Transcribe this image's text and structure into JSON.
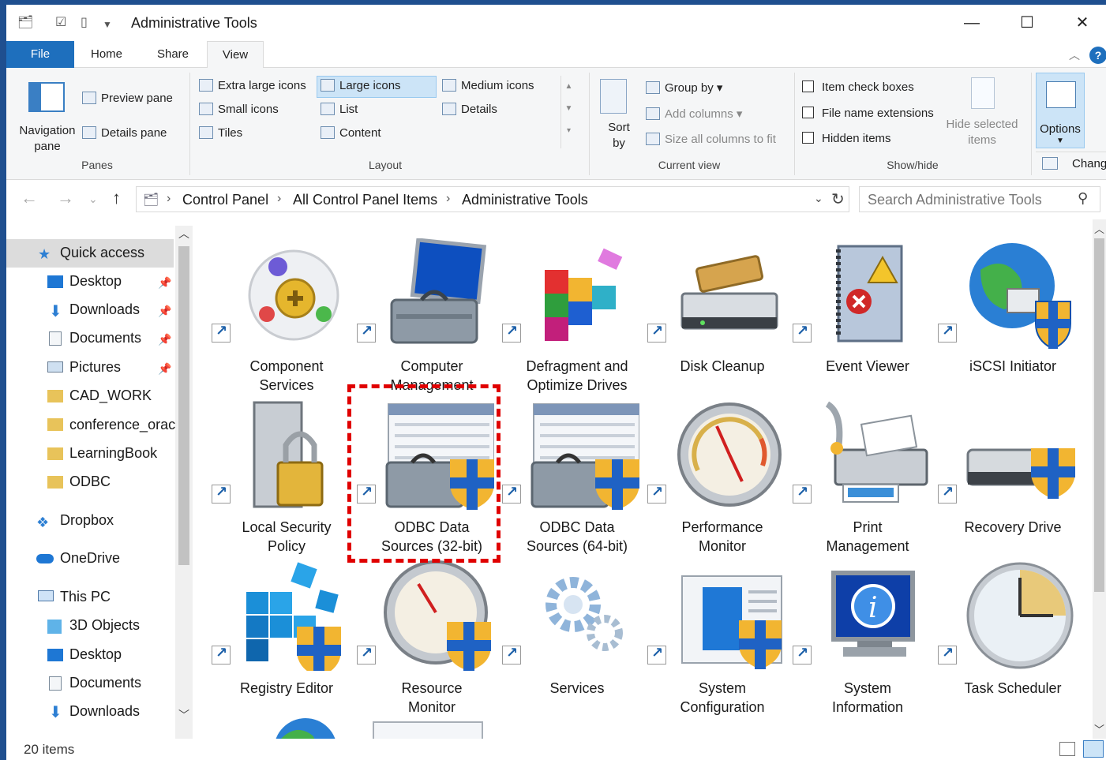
{
  "window": {
    "title": "Administrative Tools",
    "controls": {
      "minimize": "—",
      "maximize": "☐",
      "close": "✕"
    }
  },
  "ribbon_tabs": [
    "File",
    "Home",
    "Share",
    "View"
  ],
  "ribbon": {
    "panes": {
      "navigation_pane": "Navigation pane",
      "preview_pane": "Preview pane",
      "details_pane": "Details pane",
      "group_label": "Panes"
    },
    "layout": {
      "items": [
        "Extra large icons",
        "Large icons",
        "Medium icons",
        "Small icons",
        "List",
        "Details",
        "Tiles",
        "Content"
      ],
      "selected": "Large icons",
      "group_label": "Layout"
    },
    "current_view": {
      "sort_by": "Sort by",
      "group_by": "Group by",
      "add_columns": "Add columns",
      "size_all_columns": "Size all columns to fit",
      "group_label": "Current view"
    },
    "show_hide": {
      "item_check_boxes": "Item check boxes",
      "file_name_extensions": "File name extensions",
      "hidden_items": "Hidden items",
      "hide_selected_items": "Hide selected items",
      "group_label": "Show/hide"
    },
    "options": {
      "label": "Options",
      "change": "Chang"
    }
  },
  "address": {
    "crumbs": [
      "Control Panel",
      "All Control Panel Items",
      "Administrative Tools"
    ],
    "search_placeholder": "Search Administrative Tools"
  },
  "nav_pane": {
    "quick_access": "Quick access",
    "items": [
      {
        "label": "Desktop",
        "pinned": true
      },
      {
        "label": "Downloads",
        "pinned": true
      },
      {
        "label": "Documents",
        "pinned": true
      },
      {
        "label": "Pictures",
        "pinned": true
      },
      {
        "label": "CAD_WORK",
        "pinned": false
      },
      {
        "label": "conference_orac",
        "pinned": false
      },
      {
        "label": "LearningBook",
        "pinned": false
      },
      {
        "label": "ODBC",
        "pinned": false
      }
    ],
    "dropbox": "Dropbox",
    "onedrive": "OneDrive",
    "this_pc": "This PC",
    "pc_items": [
      "3D Objects",
      "Desktop",
      "Documents",
      "Downloads"
    ]
  },
  "tiles": [
    {
      "line1": "Component",
      "line2": "Services",
      "icon": "component-services-icon"
    },
    {
      "line1": "Computer",
      "line2": "Management",
      "icon": "computer-management-icon"
    },
    {
      "line1": "Defragment and",
      "line2": "Optimize Drives",
      "icon": "defragment-icon"
    },
    {
      "line1": "Disk Cleanup",
      "line2": "",
      "icon": "disk-cleanup-icon"
    },
    {
      "line1": "Event Viewer",
      "line2": "",
      "icon": "event-viewer-icon"
    },
    {
      "line1": "iSCSI Initiator",
      "line2": "",
      "icon": "iscsi-icon"
    },
    {
      "line1": "Local Security",
      "line2": "Policy",
      "icon": "local-security-policy-icon"
    },
    {
      "line1": "ODBC Data",
      "line2": "Sources (32-bit)",
      "icon": "odbc-32-icon"
    },
    {
      "line1": "ODBC Data",
      "line2": "Sources (64-bit)",
      "icon": "odbc-64-icon"
    },
    {
      "line1": "Performance",
      "line2": "Monitor",
      "icon": "performance-monitor-icon"
    },
    {
      "line1": "Print",
      "line2": "Management",
      "icon": "print-management-icon"
    },
    {
      "line1": "Recovery Drive",
      "line2": "",
      "icon": "recovery-drive-icon"
    },
    {
      "line1": "Registry Editor",
      "line2": "",
      "icon": "registry-editor-icon"
    },
    {
      "line1": "Resource",
      "line2": "Monitor",
      "icon": "resource-monitor-icon"
    },
    {
      "line1": "Services",
      "line2": "",
      "icon": "services-icon"
    },
    {
      "line1": "System",
      "line2": "Configuration",
      "icon": "system-configuration-icon"
    },
    {
      "line1": "System",
      "line2": "Information",
      "icon": "system-information-icon"
    },
    {
      "line1": "Task Scheduler",
      "line2": "",
      "icon": "task-scheduler-icon"
    }
  ],
  "status": {
    "count": "20 items"
  },
  "colors": {
    "accent": "#1e6fbd",
    "highlight": "#e00000",
    "selection": "#cce4f7"
  }
}
